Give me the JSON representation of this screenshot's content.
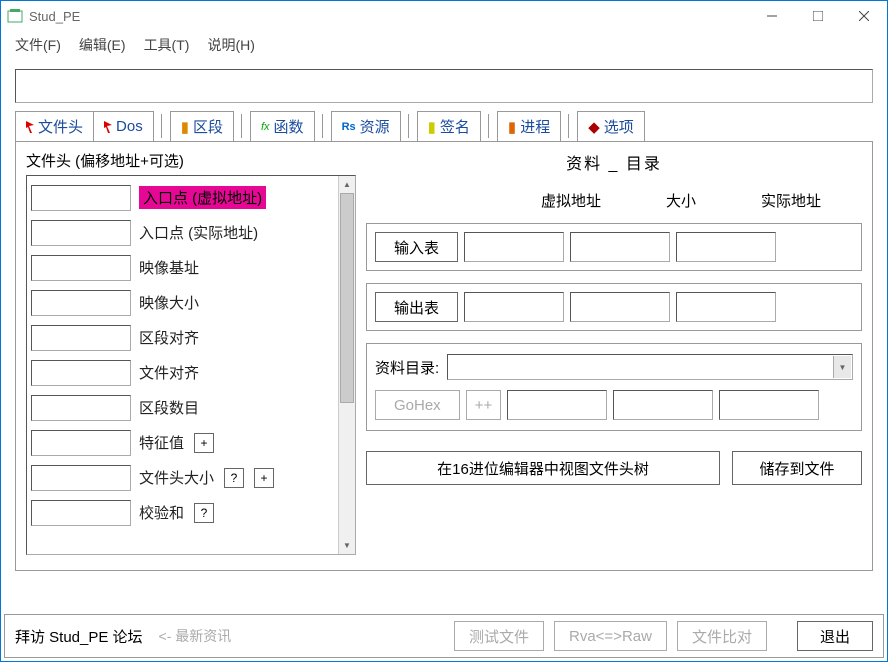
{
  "window": {
    "title": "Stud_PE"
  },
  "menu": {
    "file": "文件(F)",
    "edit": "编辑(E)",
    "tools": "工具(T)",
    "help": "说明(H)"
  },
  "tabs": {
    "header": "文件头",
    "dos": "Dos",
    "sections": "区段",
    "functions": "函数",
    "resources": "资源",
    "signature": "签名",
    "process": "进程",
    "options": "选项"
  },
  "left": {
    "title": "文件头 (偏移地址+可选)",
    "items": [
      {
        "label": "入口点 (虚拟地址)",
        "hl": true
      },
      {
        "label": "入口点 (实际地址)"
      },
      {
        "label": "映像基址"
      },
      {
        "label": "映像大小"
      },
      {
        "label": "区段对齐"
      },
      {
        "label": "文件对齐"
      },
      {
        "label": "区段数目"
      },
      {
        "label": "特征值",
        "plus": true
      },
      {
        "label": "文件头大小",
        "q": true,
        "plus": true
      },
      {
        "label": "校验和",
        "q": true
      }
    ]
  },
  "right": {
    "title": "资料 _ 目录",
    "cols": {
      "va": "虚拟地址",
      "size": "大小",
      "real": "实际地址"
    },
    "import_btn": "输入表",
    "export_btn": "输出表",
    "dir_label": "资料目录:",
    "gohex": "GoHex",
    "plusplus": "++",
    "view_tree": "在16进位编辑器中视图文件头树",
    "save_file": "储存到文件"
  },
  "status": {
    "visit": "拜访 Stud_PE 论坛",
    "news": "<- 最新资讯",
    "test": "测试文件",
    "rva": "Rva<=>Raw",
    "compare": "文件比对",
    "exit": "退出"
  },
  "btn": {
    "q": "?",
    "plus": "+"
  }
}
